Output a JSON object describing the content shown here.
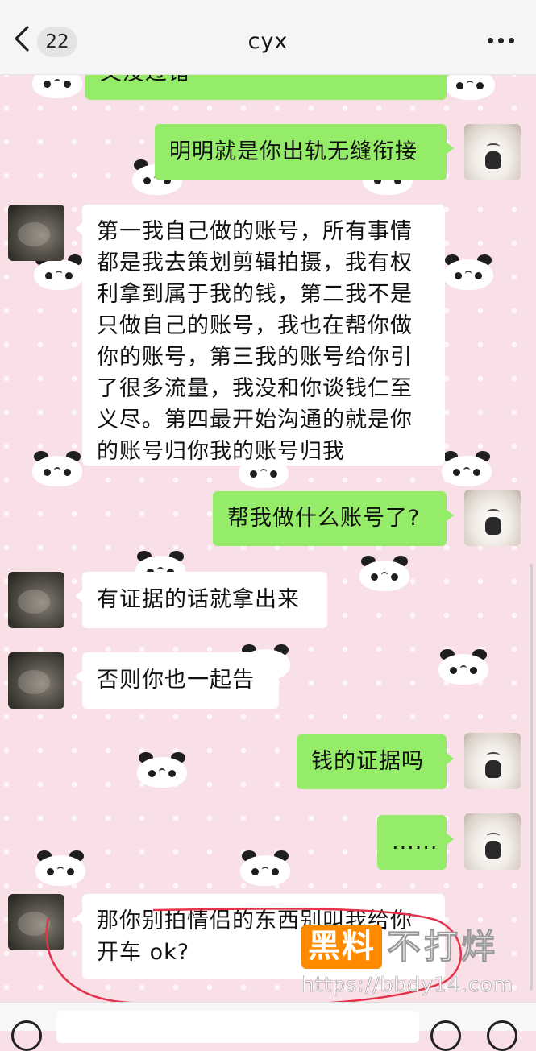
{
  "header": {
    "back_count": "22",
    "title": "cyx",
    "more_label": "more-options"
  },
  "messages": [
    {
      "from": "me",
      "text": "又没过错"
    },
    {
      "from": "me",
      "text": "明明就是你出轨无缝衔接"
    },
    {
      "from": "other",
      "text": "第一我自己做的账号，所有事情\n都是我去策划剪辑拍摄，我有权\n利拿到属于我的钱，第二我不是\n只做自己的账号，我也在帮你做\n你的账号，第三我的账号给你引\n了很多流量，我没和你谈钱仁至\n义尽。第四最开始沟通的就是你\n的账号归你我的账号归我"
    },
    {
      "from": "me",
      "text": "帮我做什么账号了?"
    },
    {
      "from": "other",
      "text": "有证据的话就拿出来"
    },
    {
      "from": "other",
      "text": "否则你也一起告"
    },
    {
      "from": "me",
      "text": "钱的证据吗"
    },
    {
      "from": "me",
      "text": "......"
    },
    {
      "from": "other",
      "text": "那你别拍情侣的东西别叫我给你\n开车 ok?"
    }
  ],
  "watermark": {
    "box_text": "黑料",
    "side_text": "不打烊",
    "url": "https://bbdy14.com"
  },
  "colors": {
    "sent_bubble": "#95ec69",
    "received_bubble": "#ffffff",
    "background": "#f9dfe6",
    "annotation": "#e3324a"
  }
}
